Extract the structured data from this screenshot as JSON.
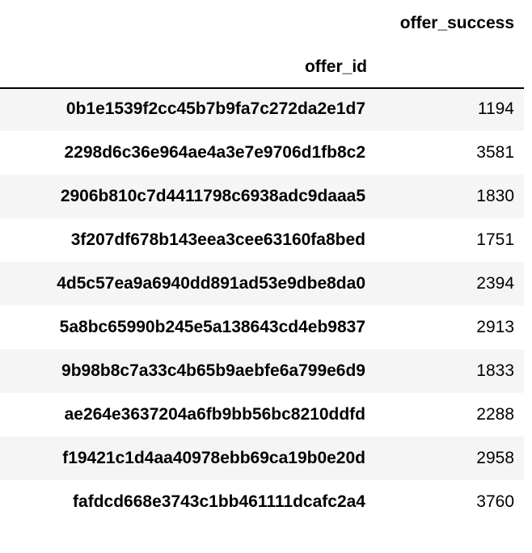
{
  "table": {
    "column_header": "offer_success",
    "index_name": "offer_id",
    "rows": [
      {
        "offer_id": "0b1e1539f2cc45b7b9fa7c272da2e1d7",
        "offer_success": "1194"
      },
      {
        "offer_id": "2298d6c36e964ae4a3e7e9706d1fb8c2",
        "offer_success": "3581"
      },
      {
        "offer_id": "2906b810c7d4411798c6938adc9daaa5",
        "offer_success": "1830"
      },
      {
        "offer_id": "3f207df678b143eea3cee63160fa8bed",
        "offer_success": "1751"
      },
      {
        "offer_id": "4d5c57ea9a6940dd891ad53e9dbe8da0",
        "offer_success": "2394"
      },
      {
        "offer_id": "5a8bc65990b245e5a138643cd4eb9837",
        "offer_success": "2913"
      },
      {
        "offer_id": "9b98b8c7a33c4b65b9aebfe6a799e6d9",
        "offer_success": "1833"
      },
      {
        "offer_id": "ae264e3637204a6fb9bb56bc8210ddfd",
        "offer_success": "2288"
      },
      {
        "offer_id": "f19421c1d4aa40978ebb69ca19b0e20d",
        "offer_success": "2958"
      },
      {
        "offer_id": "fafdcd668e3743c1bb461111dcafc2a4",
        "offer_success": "3760"
      }
    ]
  }
}
